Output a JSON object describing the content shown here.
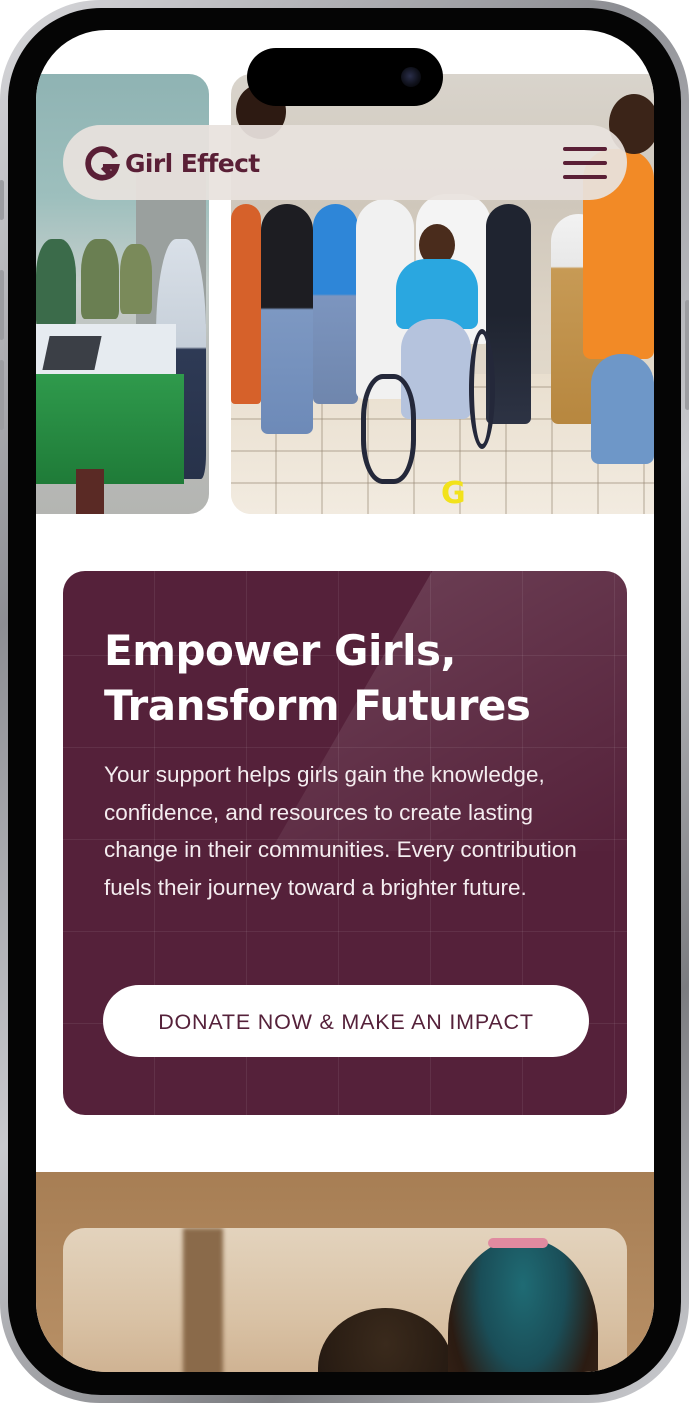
{
  "header": {
    "logo_text": "Girl Effect",
    "logo_icon": "girl-effect-g-logo",
    "menu_icon": "hamburger-menu-icon"
  },
  "hero_photos": {
    "photo_mark_icon": "yellow-g-logo-icon"
  },
  "cta": {
    "heading": "Empower Girls, Transform Futures",
    "body": "Your support helps girls gain the knowledge, confidence, and resources to create lasting change in their communities. Every contribution fuels their journey toward a brighter future.",
    "button_label": "DONATE NOW & MAKE AN IMPACT"
  },
  "colors": {
    "brand": "#55213a",
    "accent_yellow": "#f2e21b",
    "header_bg": "#e8e2de",
    "button_bg": "#ffffff"
  }
}
